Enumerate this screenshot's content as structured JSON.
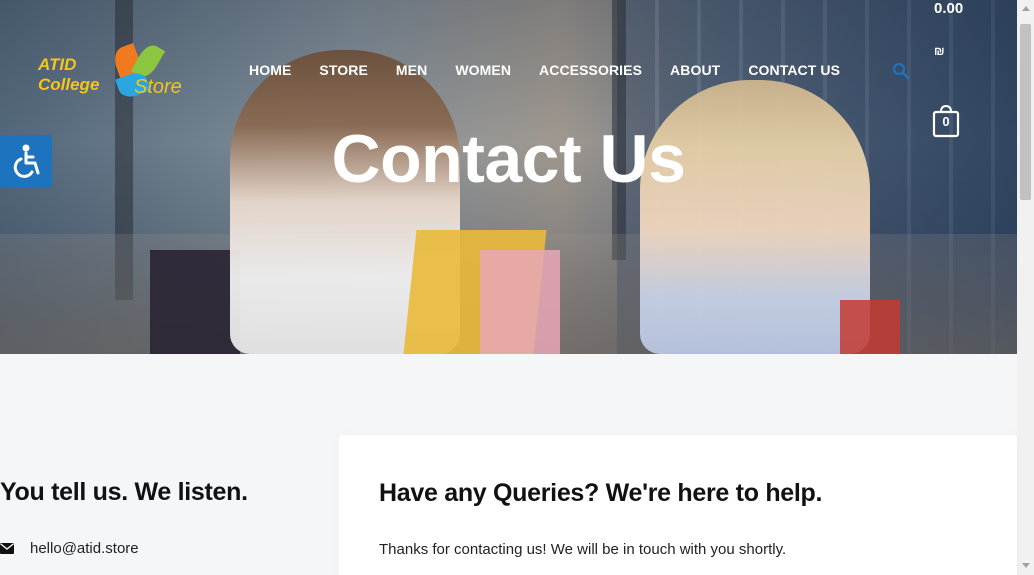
{
  "brand": {
    "line1": "ATID",
    "line2": "College",
    "line3": "Store"
  },
  "nav": [
    {
      "label": "HOME"
    },
    {
      "label": "STORE"
    },
    {
      "label": "MEN"
    },
    {
      "label": "WOMEN"
    },
    {
      "label": "ACCESSORIES"
    },
    {
      "label": "ABOUT"
    },
    {
      "label": "CONTACT US"
    }
  ],
  "cart": {
    "price": "0.00",
    "currency": "₪",
    "count": "0"
  },
  "hero": {
    "title": "Contact Us"
  },
  "contact": {
    "left_heading": "You tell us. We listen.",
    "email": "hello@atid.store",
    "card_heading": "Have any Queries? We're here to help.",
    "card_text": "Thanks for contacting us! We will be in touch with you shortly."
  },
  "colors": {
    "accent": "#1e73be",
    "logo": "#f5c518",
    "text": "#111111",
    "background": "#f5f6f8"
  },
  "icons": {
    "search": "search-icon",
    "cart": "cart-icon",
    "accessibility": "accessibility-icon",
    "mail": "mail-icon"
  }
}
